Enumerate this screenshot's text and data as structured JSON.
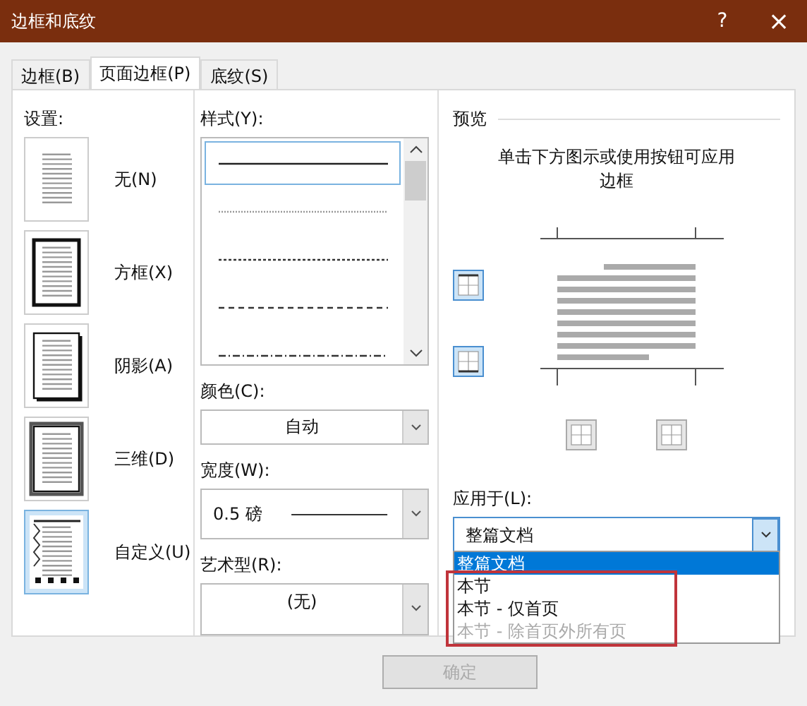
{
  "window": {
    "title": "边框和底纹",
    "help": "?",
    "close": "×"
  },
  "tabs": [
    {
      "label": "边框(B)",
      "selected": false
    },
    {
      "label": "页面边框(P)",
      "selected": true
    },
    {
      "label": "底纹(S)",
      "selected": false
    }
  ],
  "settings": {
    "label": "设置:",
    "items": [
      {
        "kind": "none",
        "label": "无(N)",
        "selected": false
      },
      {
        "kind": "box",
        "label": "方框(X)",
        "selected": false
      },
      {
        "kind": "shadow",
        "label": "阴影(A)",
        "selected": false
      },
      {
        "kind": "threed",
        "label": "三维(D)",
        "selected": false
      },
      {
        "kind": "custom",
        "label": "自定义(U)",
        "selected": true
      }
    ]
  },
  "style": {
    "label": "样式(Y):",
    "lines": [
      {
        "kind": "solid",
        "selected": true
      },
      {
        "kind": "dotted",
        "selected": false
      },
      {
        "kind": "fine-dashed",
        "selected": false
      },
      {
        "kind": "dashed",
        "selected": false
      },
      {
        "kind": "dash-dot",
        "selected": false
      }
    ]
  },
  "color": {
    "label": "颜色(C):",
    "value": "自动"
  },
  "width": {
    "label": "宽度(W):",
    "value": "0.5 磅"
  },
  "art": {
    "label": "艺术型(R):",
    "value": "(无)"
  },
  "preview": {
    "label": "预览",
    "instruction": "单击下方图示或使用按钮可应用边框",
    "toggles": [
      {
        "kind": "top",
        "on": true
      },
      {
        "kind": "bottom",
        "on": true
      },
      {
        "kind": "left",
        "on": false
      },
      {
        "kind": "right",
        "on": false
      }
    ]
  },
  "apply_to": {
    "label": "应用于(L):",
    "value": "整篇文档",
    "options": [
      {
        "label": "整篇文档",
        "selected": true,
        "disabled": false
      },
      {
        "label": "本节",
        "selected": false,
        "disabled": false
      },
      {
        "label": "本节 - 仅首页",
        "selected": false,
        "disabled": false
      },
      {
        "label": "本节 - 除首页外所有页",
        "selected": false,
        "disabled": true
      }
    ]
  },
  "buttons": [
    "确定"
  ]
}
